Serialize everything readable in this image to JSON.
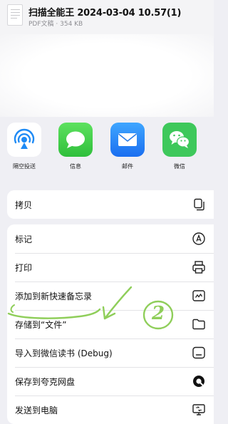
{
  "header": {
    "title": "扫描全能王 2024-03-04 10.57(1)",
    "subtitle": "PDF文稿 · 354 KB"
  },
  "apps": [
    {
      "label": "隔空投送",
      "icon": "airdrop-icon"
    },
    {
      "label": "信息",
      "icon": "messages-icon"
    },
    {
      "label": "邮件",
      "icon": "mail-icon"
    },
    {
      "label": "微信",
      "icon": "wechat-icon"
    }
  ],
  "actions_top": [
    {
      "label": "拷贝",
      "icon": "copy-icon"
    }
  ],
  "actions": [
    {
      "label": "标记",
      "icon": "markup-icon"
    },
    {
      "label": "打印",
      "icon": "printer-icon"
    },
    {
      "label": "添加到新快速备忘录",
      "icon": "quick-note-icon"
    },
    {
      "label": "存储到“文件”",
      "icon": "folder-icon"
    },
    {
      "label": "导入到微信读书 (Debug)",
      "icon": "weread-icon"
    },
    {
      "label": "保存到夸克网盘",
      "icon": "quark-icon"
    },
    {
      "label": "发送到电脑",
      "icon": "send-to-pc-icon"
    }
  ],
  "annotation": {
    "number": "2",
    "color": "#8fce5a"
  }
}
